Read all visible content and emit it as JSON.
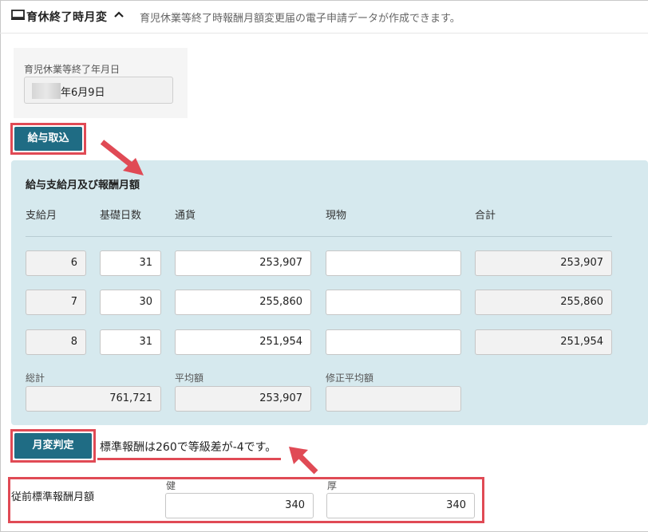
{
  "header": {
    "title": "育休終了時月変",
    "description": "育児休業等終了時報酬月額変更届の電子申請データが作成できます。"
  },
  "end_date": {
    "label": "育児休業等終了年月日",
    "value": "年6月9日"
  },
  "import_button": "給与取込",
  "salary": {
    "title": "給与支給月及び報酬月額",
    "columns": [
      "支給月",
      "基礎日数",
      "通貨",
      "現物",
      "合計"
    ],
    "rows": [
      {
        "month": "6",
        "days": "31",
        "currency": "253,907",
        "in_kind": "",
        "total": "253,907"
      },
      {
        "month": "7",
        "days": "30",
        "currency": "255,860",
        "in_kind": "",
        "total": "255,860"
      },
      {
        "month": "8",
        "days": "31",
        "currency": "251,954",
        "in_kind": "",
        "total": "251,954"
      }
    ],
    "sum_label": "総計",
    "sum_value": "761,721",
    "avg_label": "平均額",
    "avg_value": "253,907",
    "adj_avg_label": "修正平均額",
    "adj_avg_value": ""
  },
  "judge_button": "月変判定",
  "result_text": "標準報酬は260で等級差が-4です。",
  "previous": {
    "label": "従前標準報酬月額",
    "health_label": "健",
    "health_value": "340",
    "pension_label": "厚",
    "pension_value": "340"
  },
  "colors": {
    "accent": "#1f6c84",
    "panel": "#d6e9ee",
    "highlight": "#e04a55"
  },
  "icons": [
    "monitor-icon",
    "chevron-up-icon",
    "arrow-icon"
  ]
}
